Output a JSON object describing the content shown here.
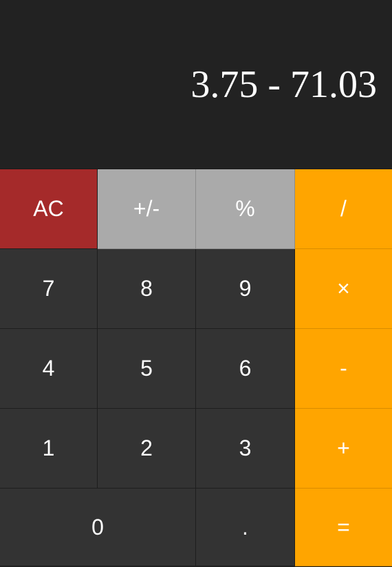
{
  "display": {
    "expression": "3.75 - 71.03"
  },
  "keys": {
    "clear": "AC",
    "sign": "+/-",
    "percent": "%",
    "divide": "/",
    "seven": "7",
    "eight": "8",
    "nine": "9",
    "multiply": "×",
    "four": "4",
    "five": "5",
    "six": "6",
    "subtract": "-",
    "one": "1",
    "two": "2",
    "three": "3",
    "add": "+",
    "zero": "0",
    "decimal": ".",
    "equals": "="
  },
  "colors": {
    "background": "#222222",
    "number_key": "#333333",
    "function_key": "#aaaaaa",
    "operator_key": "#ffa500",
    "clear_key": "#a52a2a",
    "text": "#ffffff"
  }
}
